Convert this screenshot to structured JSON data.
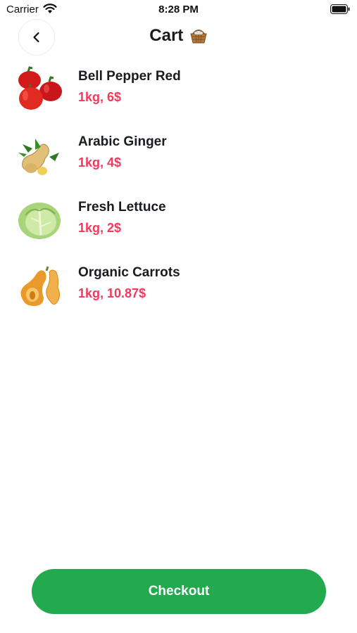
{
  "status_bar": {
    "carrier": "Carrier",
    "time": "8:28 PM"
  },
  "header": {
    "title": "Cart",
    "back_icon": "chevron-left-icon",
    "title_icon": "basket-icon"
  },
  "cart": {
    "items": [
      {
        "name": "Bell Pepper Red",
        "price": "1kg, 6$",
        "image": "bell-pepper-image"
      },
      {
        "name": "Arabic Ginger",
        "price": "1kg, 4$",
        "image": "ginger-image"
      },
      {
        "name": "Fresh Lettuce",
        "price": "1kg, 2$",
        "image": "lettuce-image"
      },
      {
        "name": "Organic Carrots",
        "price": "1kg, 10.87$",
        "image": "butternut-squash-image"
      }
    ]
  },
  "checkout": {
    "label": "Checkout"
  },
  "colors": {
    "price": "#ef3a5d",
    "checkout": "#23a94e",
    "title": "#181b1f"
  }
}
